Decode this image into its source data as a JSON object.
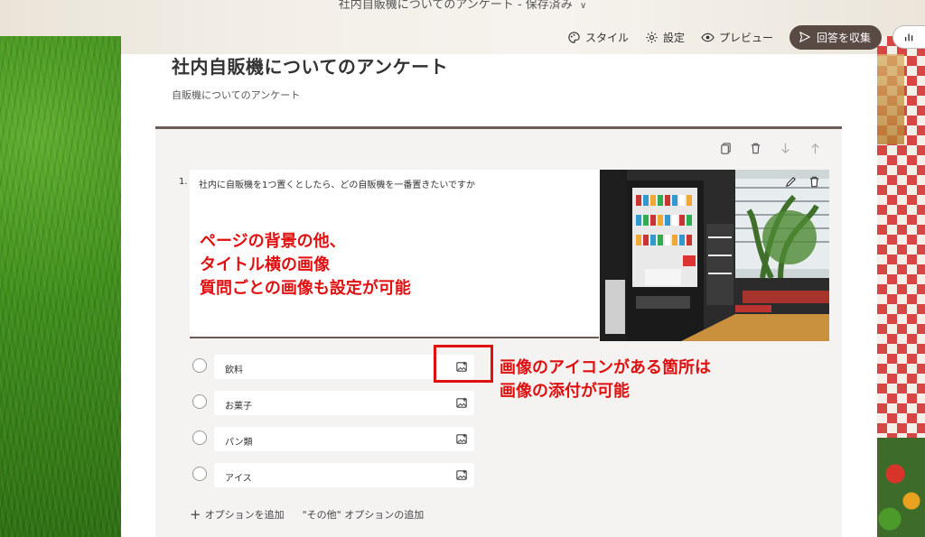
{
  "header": {
    "title": "社内自販機についてのアンケート",
    "status": "保存済み"
  },
  "toolbar": {
    "style_label": "スタイル",
    "settings_label": "設定",
    "preview_label": "プレビュー",
    "collect_label": "回答を収集"
  },
  "form": {
    "title": "社内自販機についてのアンケート",
    "subtitle": "自販機についてのアンケート"
  },
  "question": {
    "number": "1.",
    "text": "社内に自販機を1つ置くとしたら、どの自販機を一番置きたいですか",
    "options": [
      {
        "label": "飲料"
      },
      {
        "label": "お菓子"
      },
      {
        "label": "パン類"
      },
      {
        "label": "アイス"
      }
    ],
    "add_option_label": "オプションを追加",
    "add_other_label": "\"その他\" オプションの追加"
  },
  "annotations": {
    "main_line1": "ページの背景の他、",
    "main_line2": "タイトル横の画像",
    "main_line3": "質問ごとの画像も設定が可能",
    "side_line1": "画像のアイコンがある箇所は",
    "side_line2": "画像の添付が可能"
  },
  "colors": {
    "accent": "#5a4a44",
    "annotation": "#e01010",
    "question_bg": "#f4f3f2"
  }
}
